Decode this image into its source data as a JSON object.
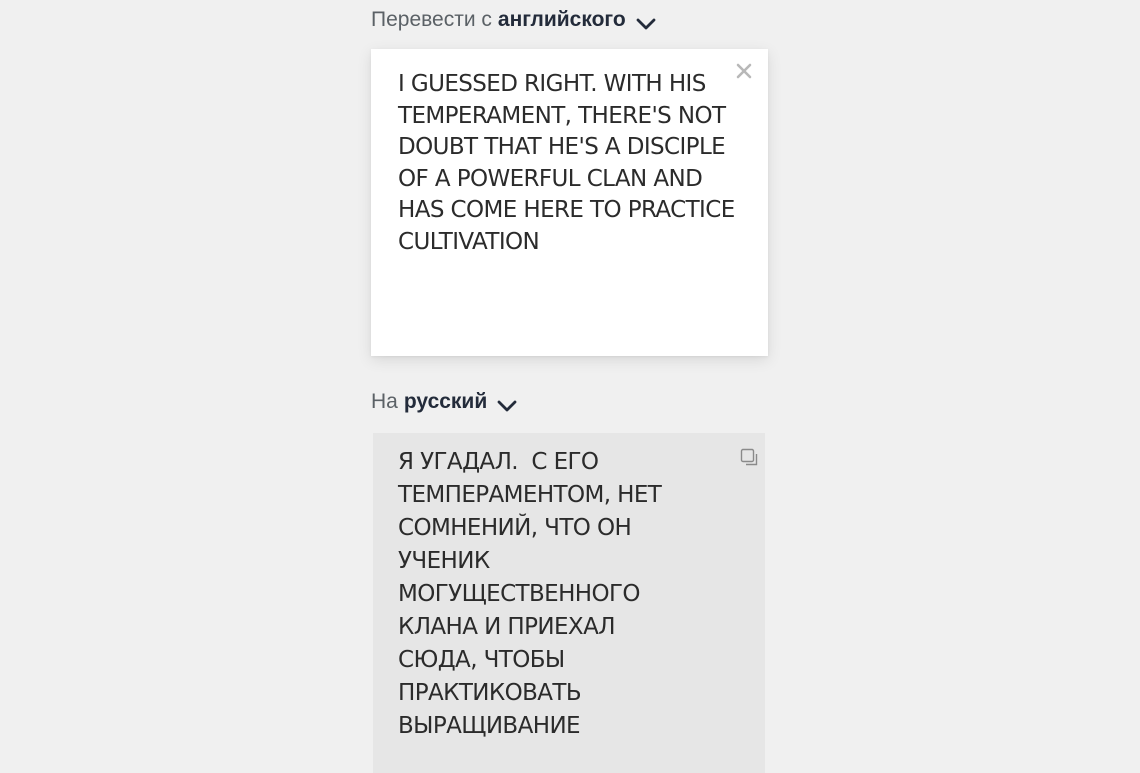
{
  "source_lang": {
    "prefix": "Перевести с",
    "language": "английского"
  },
  "source_input": {
    "text": "I GUESSED RIGHT. WITH HIS\nTEMPERAMENT, THERE'S NOT\nDOUBT THAT HE'S A DISCIPLE\nOF A POWERFUL CLAN AND\nHAS COME HERE TO PRACTICE\nCULTIVATION"
  },
  "target_lang": {
    "prefix": "На",
    "language": "русский"
  },
  "target_output": {
    "text": "Я УГАДАЛ.  С ЕГО\nТЕМПЕРАМЕНТОМ, НЕТ\nСОМНЕНИЙ, ЧТО ОН\nУЧЕНИК\nМОГУЩЕСТВЕННОГО\nКЛАНА И ПРИЕХАЛ\nСЮДА, ЧТОБЫ\nПРАКТИКОВАТЬ\nВЫРАЩИВАНИЕ"
  },
  "icons": {
    "chevron": "chevron-down-icon",
    "clear": "close-icon",
    "copy": "copy-icon"
  },
  "colors": {
    "background": "#f0f0f0",
    "language_bold": "#232b3a",
    "prefix_text": "#5b6166",
    "output_background": "#e6e6e6"
  }
}
